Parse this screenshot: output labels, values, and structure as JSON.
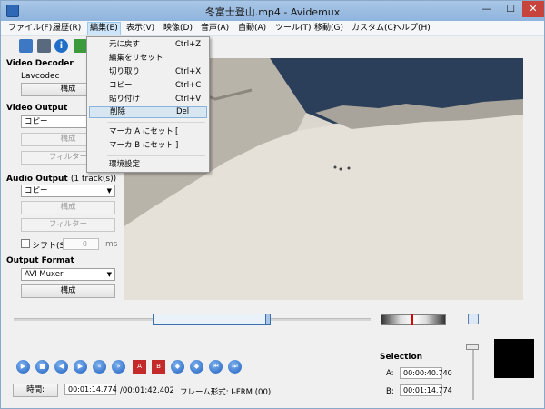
{
  "window": {
    "title": "冬富士登山.mp4 - Avidemux",
    "minimize": "—",
    "maximize": "☐",
    "close": "✕"
  },
  "menubar": [
    "ファイル(F)",
    "履歴(R)",
    "編集(E)",
    "表示(V)",
    "映像(D)",
    "音声(A)",
    "自動(A)",
    "ツール(T)",
    "移動(G)",
    "カスタム(C)",
    "ヘルプ(H)"
  ],
  "toolbar": {
    "info_glyph": "i"
  },
  "edit_menu": {
    "items": [
      {
        "label": "元に戻す",
        "shortcut": "Ctrl+Z"
      },
      {
        "label": "編集をリセット",
        "shortcut": ""
      },
      {
        "label": "切り取り",
        "shortcut": "Ctrl+X"
      },
      {
        "label": "コピー",
        "shortcut": "Ctrl+C"
      },
      {
        "label": "貼り付け",
        "shortcut": "Ctrl+V"
      },
      {
        "label": "削除",
        "shortcut": "Del"
      },
      {
        "label": "マーカ A にセット",
        "shortcut": "["
      },
      {
        "label": "マーカ B にセット",
        "shortcut": "]"
      },
      {
        "label": "環境設定",
        "shortcut": ""
      }
    ],
    "highlighted": "削除"
  },
  "left_panel": {
    "video_decoder": {
      "title": "Video Decoder",
      "codec": "Lavcodec",
      "configure": "構成"
    },
    "video_output": {
      "title": "Video Output",
      "mode": "コピー",
      "configure": "構成",
      "filters": "フィルター"
    },
    "audio_output": {
      "title": "Audio Output",
      "tracks": "(1 track(s))",
      "mode": "コピー",
      "configure": "構成",
      "filters": "フィルター",
      "shift_label": "シフト(S):",
      "shift_value": "0",
      "shift_unit": "ms"
    },
    "output_format": {
      "title": "Output Format",
      "muxer": "AVI Muxer",
      "configure": "構成"
    }
  },
  "transport": {
    "buttons": [
      "play",
      "stop",
      "prev-frame",
      "next-frame",
      "prev-keyframe",
      "next-keyframe",
      "marker-a",
      "marker-b",
      "prev-black",
      "next-black",
      "go-start",
      "go-end"
    ],
    "glyphs": [
      "▶",
      "■",
      "◀",
      "▶",
      "«",
      "»",
      "A",
      "B",
      "◆",
      "◆",
      "⏮",
      "⏭"
    ],
    "colors": {
      "blue": "#1e5fbf",
      "red": "#c42a2a"
    }
  },
  "selection": {
    "title": "Selection",
    "a_label": "A:",
    "a_value": "00:00:40.740",
    "b_label": "B:",
    "b_value": "00:01:14.774"
  },
  "status": {
    "time_button": "時間:",
    "current_time": "00:01:14.774",
    "total_time": "/00:01:42.402",
    "frame_type": "フレーム形式: I-FRM (00)"
  }
}
